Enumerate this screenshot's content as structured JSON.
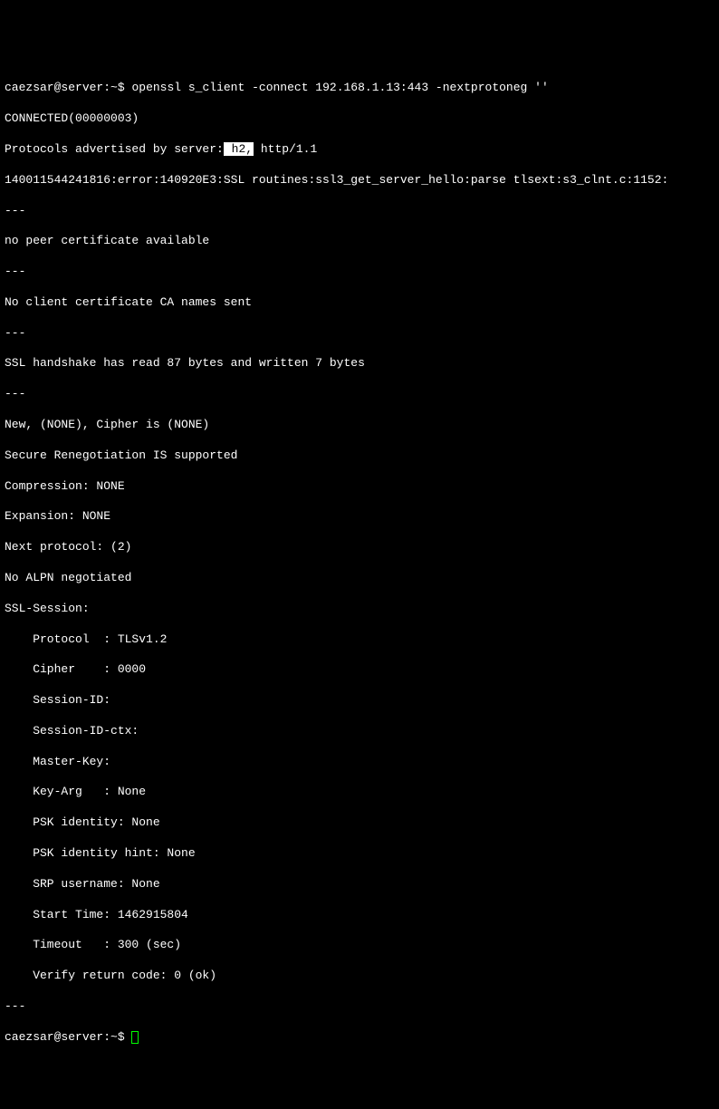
{
  "prompt1": {
    "user": "caezsar",
    "at": "@",
    "host": "server",
    "colon": ":",
    "path": "~",
    "symbol": "$ ",
    "command": "openssl s_client -connect 192.168.1.13:443 -nextprotoneg ''"
  },
  "lines": {
    "connected": "CONNECTED(00000003)",
    "protoLabel": "Protocols advertised by server:",
    "protoHighlight": " h2,",
    "protoRest": " http/1.1",
    "error": "140011544241816:error:140920E3:SSL routines:ssl3_get_server_hello:parse tlsext:s3_clnt.c:1152:",
    "sep1": "---",
    "noPeer": "no peer certificate available",
    "sep2": "---",
    "noClient": "No client certificate CA names sent",
    "sep3": "---",
    "handshake": "SSL handshake has read 87 bytes and written 7 bytes",
    "sep4": "---",
    "newCipher": "New, (NONE), Cipher is (NONE)",
    "secureReneg": "Secure Renegotiation IS supported",
    "compression": "Compression: NONE",
    "expansion": "Expansion: NONE",
    "nextProto": "Next protocol: (2)",
    "noAlpn": "No ALPN negotiated",
    "sslSession": "SSL-Session:",
    "protocol": "    Protocol  : TLSv1.2",
    "cipher": "    Cipher    : 0000",
    "sessionId": "    Session-ID:",
    "sessionIdCtx": "    Session-ID-ctx:",
    "masterKey": "    Master-Key:",
    "keyArg": "    Key-Arg   : None",
    "pskIdentity": "    PSK identity: None",
    "pskHint": "    PSK identity hint: None",
    "srpUser": "    SRP username: None",
    "startTime": "    Start Time: 1462915804",
    "timeout": "    Timeout   : 300 (sec)",
    "verify": "    Verify return code: 0 (ok)",
    "sep5": "---"
  },
  "prompt2": {
    "user": "caezsar",
    "at": "@",
    "host": "server",
    "colon": ":",
    "path": "~",
    "symbol": "$ "
  }
}
